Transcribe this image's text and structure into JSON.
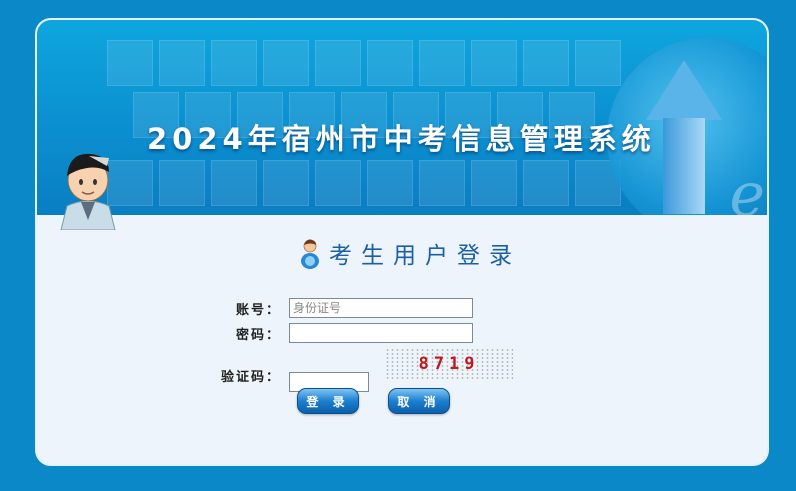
{
  "banner": {
    "title": "2024年宿州市中考信息管理系统"
  },
  "login": {
    "heading": "考生用户登录",
    "account_label": "账号：",
    "account_placeholder": "身份证号",
    "account_value": "",
    "password_label": "密码：",
    "password_value": "",
    "captcha_label": "验证码：",
    "captcha_value": "",
    "captcha_text": "8719",
    "login_button": "登 录",
    "cancel_button": "取 消"
  },
  "colors": {
    "background": "#0a88c8",
    "heading": "#1b5fa6",
    "captcha_text": "#c0181c",
    "button": "#1d7fcf"
  },
  "icons": [
    "user-icon",
    "mascot-avatar"
  ]
}
